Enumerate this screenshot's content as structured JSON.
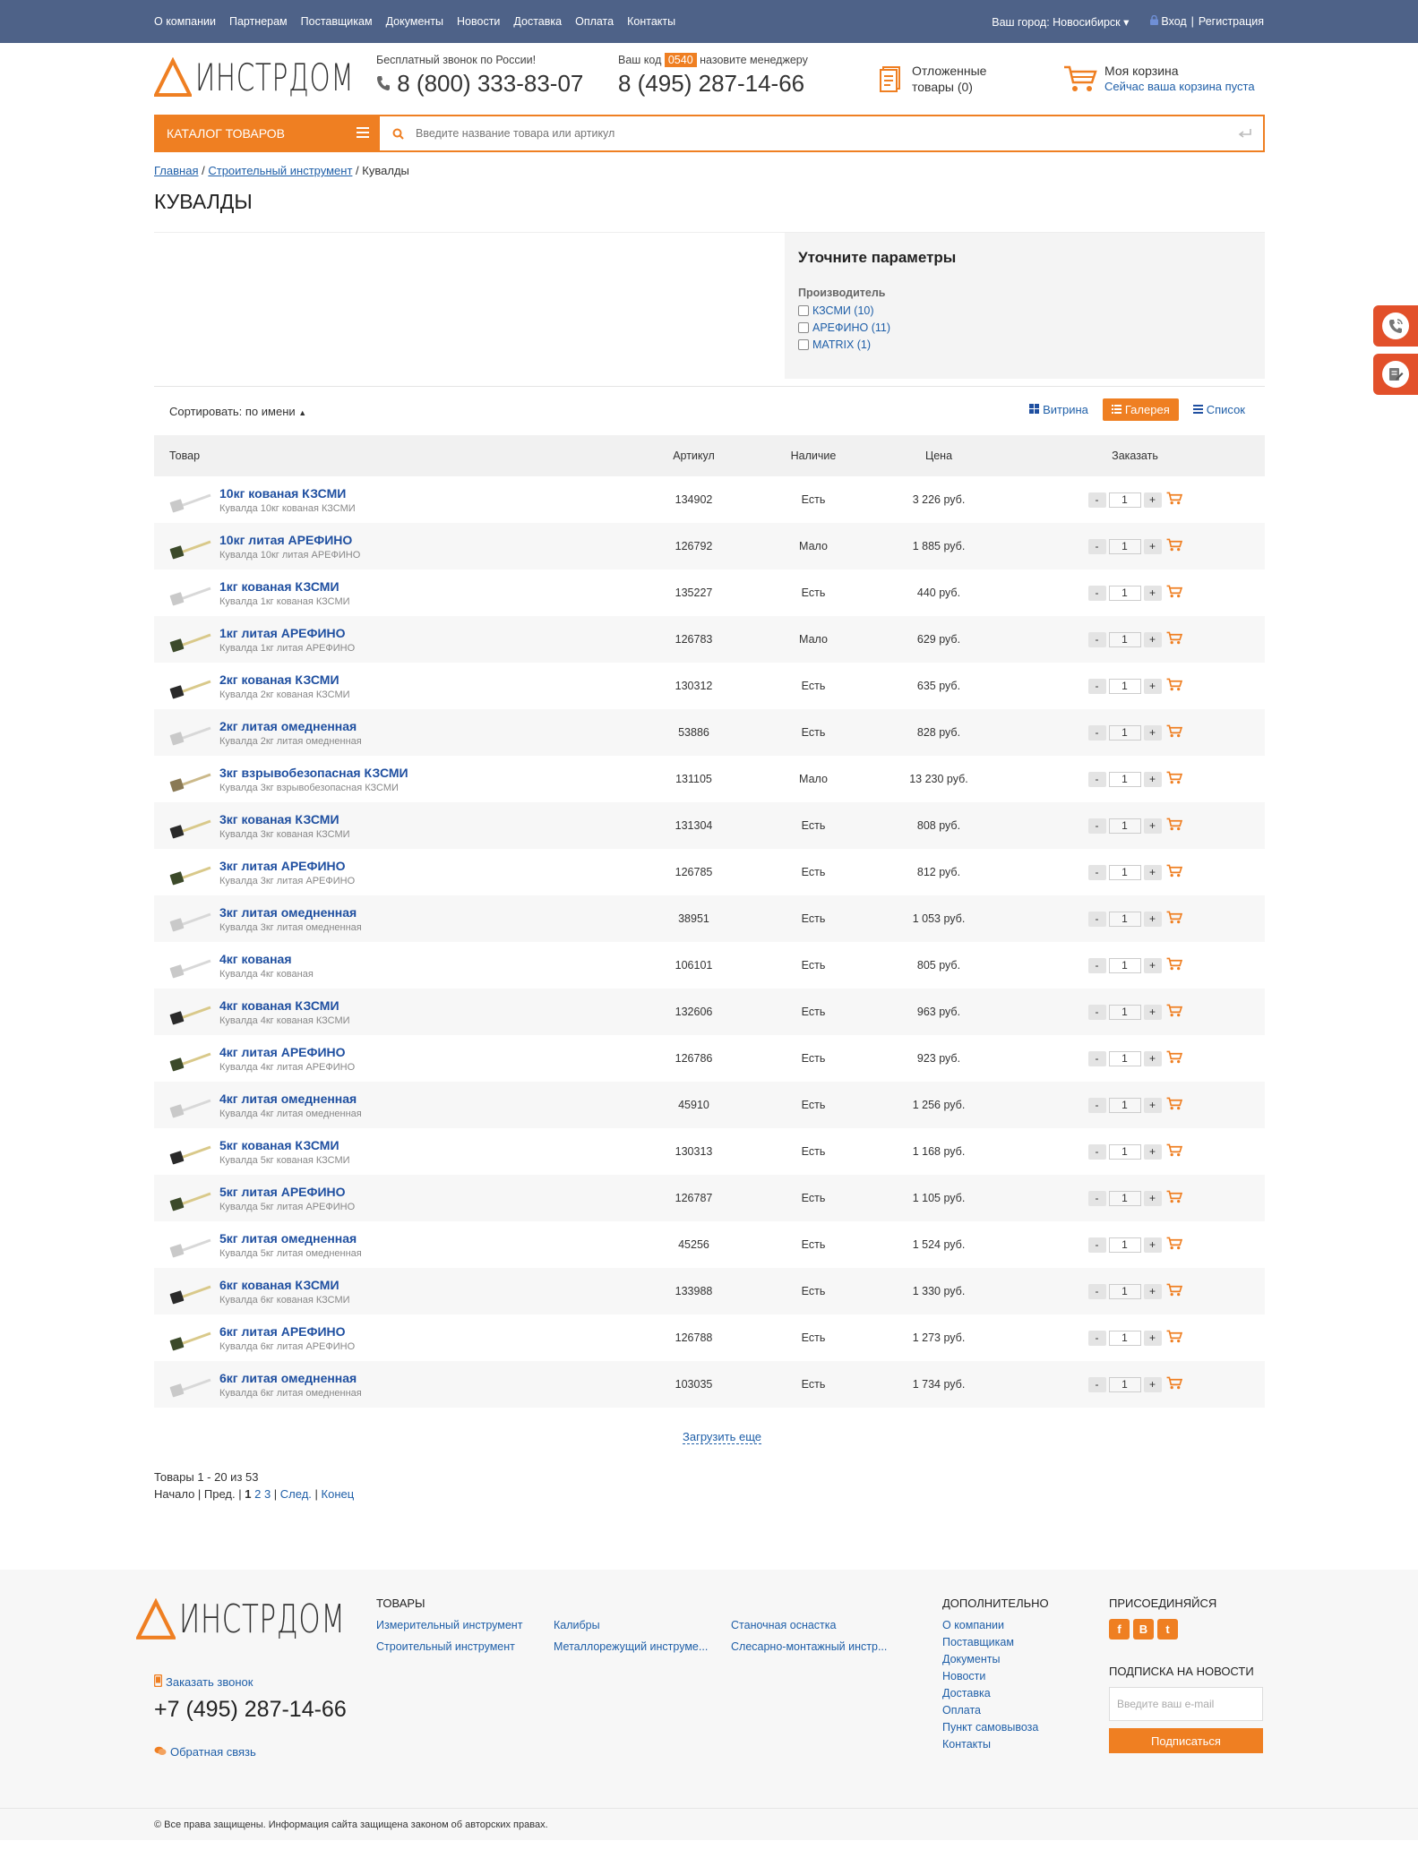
{
  "topnav": {
    "links": [
      "О компании",
      "Партнерам",
      "Поставщикам",
      "Документы",
      "Новости",
      "Доставка",
      "Оплата",
      "Контакты"
    ],
    "city": "Ваш город: Новосибирск",
    "login": "Вход",
    "separator": "|",
    "register": "Регистрация"
  },
  "header": {
    "logo_text": "ИНСТРДОМ",
    "free_call_label": "Бесплатный звонок по России!",
    "free_phone": "8 (800) 333-83-07",
    "code_prefix": "Ваш код",
    "code": "0540",
    "code_suffix": "назовите менеджеру",
    "manager_phone": "8 (495) 287-14-66",
    "saved_line1": "Отложенные",
    "saved_line2": "товары (0)",
    "cart_title": "Моя корзина",
    "cart_status": "Сейчас ваша корзина пуста"
  },
  "search": {
    "catalog_label": "КАТАЛОГ ТОВАРОВ",
    "placeholder": "Введите название товара или артикул"
  },
  "breadcrumb": {
    "home": "Главная",
    "sep": "/",
    "section": "Строительный инструмент",
    "current": "Кувалды"
  },
  "page_title": "КУВАЛДЫ",
  "filter": {
    "title": "Уточните параметры",
    "group": "Производитель",
    "options": [
      "КЗСМИ (10)",
      "АРЕФИНО (11)",
      "MATRIX (1)"
    ]
  },
  "sort": {
    "label": "Сортировать: по имени"
  },
  "views": [
    "Витрина",
    "Галерея",
    "Список"
  ],
  "table": {
    "headers": [
      "Товар",
      "Артикул",
      "Наличие",
      "Цена",
      "Заказать"
    ],
    "rows": [
      {
        "name": "10кг кованая КЗСМИ",
        "desc": "Кувалда 10кг кованая КЗСМИ",
        "sku": "134902",
        "stock": "Есть",
        "price": "3 226 руб.",
        "qty": "1",
        "img": "silver"
      },
      {
        "name": "10кг литая АРЕФИНО",
        "desc": "Кувалда 10кг литая АРЕФИНО",
        "sku": "126792",
        "stock": "Мало",
        "price": "1 885 руб.",
        "qty": "1",
        "img": "green"
      },
      {
        "name": "1кг кованая КЗСМИ",
        "desc": "Кувалда 1кг кованая КЗСМИ",
        "sku": "135227",
        "stock": "Есть",
        "price": "440 руб.",
        "qty": "1",
        "img": "silver"
      },
      {
        "name": "1кг литая АРЕФИНО",
        "desc": "Кувалда 1кг литая АРЕФИНО",
        "sku": "126783",
        "stock": "Мало",
        "price": "629 руб.",
        "qty": "1",
        "img": "green"
      },
      {
        "name": "2кг кованая КЗСМИ",
        "desc": "Кувалда 2кг кованая КЗСМИ",
        "sku": "130312",
        "stock": "Есть",
        "price": "635 руб.",
        "qty": "1",
        "img": "black"
      },
      {
        "name": "2кг литая омедненная",
        "desc": "Кувалда 2кг литая омедненная",
        "sku": "53886",
        "stock": "Есть",
        "price": "828 руб.",
        "qty": "1",
        "img": "silver"
      },
      {
        "name": "3кг взрывобезопасная КЗСМИ",
        "desc": "Кувалда 3кг взрывобезопасная КЗСМИ",
        "sku": "131105",
        "stock": "Мало",
        "price": "13 230 руб.",
        "qty": "1",
        "img": "bronze"
      },
      {
        "name": "3кг кованая КЗСМИ",
        "desc": "Кувалда 3кг кованая КЗСМИ",
        "sku": "131304",
        "stock": "Есть",
        "price": "808 руб.",
        "qty": "1",
        "img": "black"
      },
      {
        "name": "3кг литая АРЕФИНО",
        "desc": "Кувалда 3кг литая АРЕФИНО",
        "sku": "126785",
        "stock": "Есть",
        "price": "812 руб.",
        "qty": "1",
        "img": "green"
      },
      {
        "name": "3кг литая омедненная",
        "desc": "Кувалда 3кг литая омедненная",
        "sku": "38951",
        "stock": "Есть",
        "price": "1 053 руб.",
        "qty": "1",
        "img": "silver"
      },
      {
        "name": "4кг кованая",
        "desc": "Кувалда 4кг кованая",
        "sku": "106101",
        "stock": "Есть",
        "price": "805 руб.",
        "qty": "1",
        "img": "silver"
      },
      {
        "name": "4кг кованая КЗСМИ",
        "desc": "Кувалда 4кг кованая КЗСМИ",
        "sku": "132606",
        "stock": "Есть",
        "price": "963 руб.",
        "qty": "1",
        "img": "black"
      },
      {
        "name": "4кг литая АРЕФИНО",
        "desc": "Кувалда 4кг литая АРЕФИНО",
        "sku": "126786",
        "stock": "Есть",
        "price": "923 руб.",
        "qty": "1",
        "img": "green"
      },
      {
        "name": "4кг литая омедненная",
        "desc": "Кувалда 4кг литая омедненная",
        "sku": "45910",
        "stock": "Есть",
        "price": "1 256 руб.",
        "qty": "1",
        "img": "silver"
      },
      {
        "name": "5кг кованая КЗСМИ",
        "desc": "Кувалда 5кг кованая КЗСМИ",
        "sku": "130313",
        "stock": "Есть",
        "price": "1 168 руб.",
        "qty": "1",
        "img": "black"
      },
      {
        "name": "5кг литая АРЕФИНО",
        "desc": "Кувалда 5кг литая АРЕФИНО",
        "sku": "126787",
        "stock": "Есть",
        "price": "1 105 руб.",
        "qty": "1",
        "img": "green"
      },
      {
        "name": "5кг литая омедненная",
        "desc": "Кувалда 5кг литая омедненная",
        "sku": "45256",
        "stock": "Есть",
        "price": "1 524 руб.",
        "qty": "1",
        "img": "silver"
      },
      {
        "name": "6кг кованая КЗСМИ",
        "desc": "Кувалда 6кг кованая КЗСМИ",
        "sku": "133988",
        "stock": "Есть",
        "price": "1 330 руб.",
        "qty": "1",
        "img": "black"
      },
      {
        "name": "6кг литая АРЕФИНО",
        "desc": "Кувалда 6кг литая АРЕФИНО",
        "sku": "126788",
        "stock": "Есть",
        "price": "1 273 руб.",
        "qty": "1",
        "img": "green"
      },
      {
        "name": "6кг литая омедненная",
        "desc": "Кувалда 6кг литая омедненная",
        "sku": "103035",
        "stock": "Есть",
        "price": "1 734 руб.",
        "qty": "1",
        "img": "silver"
      }
    ]
  },
  "load_more": "Загрузить еще",
  "pager": {
    "summary": "Товары 1 - 20 из 53",
    "start": "Начало",
    "prev": "Пред.",
    "pages": [
      "1",
      "2",
      "3"
    ],
    "next": "След.",
    "end": "Конец"
  },
  "footer": {
    "logo_text": "ИНСТРДОМ",
    "callback": "Заказать звонок",
    "phone": "+7 (495) 287-14-66",
    "feedback": "Обратная связь",
    "goods_title": "ТОВАРЫ",
    "goods": [
      "Измерительный инструмент",
      "Строительный инструмент",
      "Калибры",
      "Металлорежущий инструме...",
      "Станочная оснастка",
      "Слесарно-монтажный инстр..."
    ],
    "extra_title": "ДОПОЛНИТЕЛЬНО",
    "extra": [
      "О компании",
      "Поставщикам",
      "Документы",
      "Новости",
      "Доставка",
      "Оплата",
      "Пункт самовывоза",
      "Контакты"
    ],
    "join_title": "ПРИСОЕДИНЯЙСЯ",
    "social": [
      "f",
      "В",
      "t"
    ],
    "subscribe_title": "ПОДПИСКА НА НОВОСТИ",
    "email_placeholder": "Введите ваш e-mail",
    "subscribe_button": "Подписаться"
  },
  "copyright": "© Все права защищены. Информация сайта защищена законом об авторских правах.",
  "colors": {
    "accent": "#ef7f22",
    "topbar": "#4e6288",
    "link": "#1f5fa8",
    "side": "#e2502a"
  }
}
